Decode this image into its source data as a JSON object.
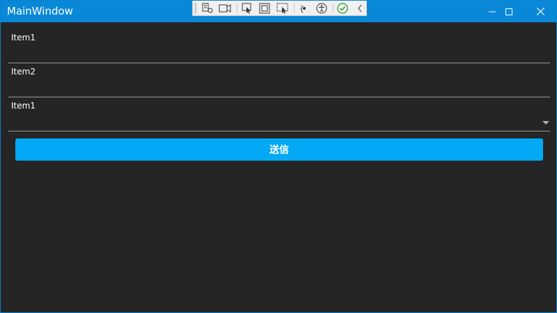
{
  "window": {
    "title": "MainWindow",
    "accent_color": "#0a88d8"
  },
  "debug_toolbar": {
    "icons": [
      "visual-tree-icon",
      "record-icon",
      "select-element-icon",
      "display-layout-adorners-icon",
      "track-focus-icon",
      "binding-failures-icon",
      "accessibility-icon",
      "hot-reload-ok-icon",
      "collapse-chevron-icon"
    ]
  },
  "form": {
    "field1_label": "Item1",
    "field2_label": "Item2",
    "combo_label": "Item1",
    "submit_label": "送信",
    "submit_color": "#03a9f4"
  }
}
